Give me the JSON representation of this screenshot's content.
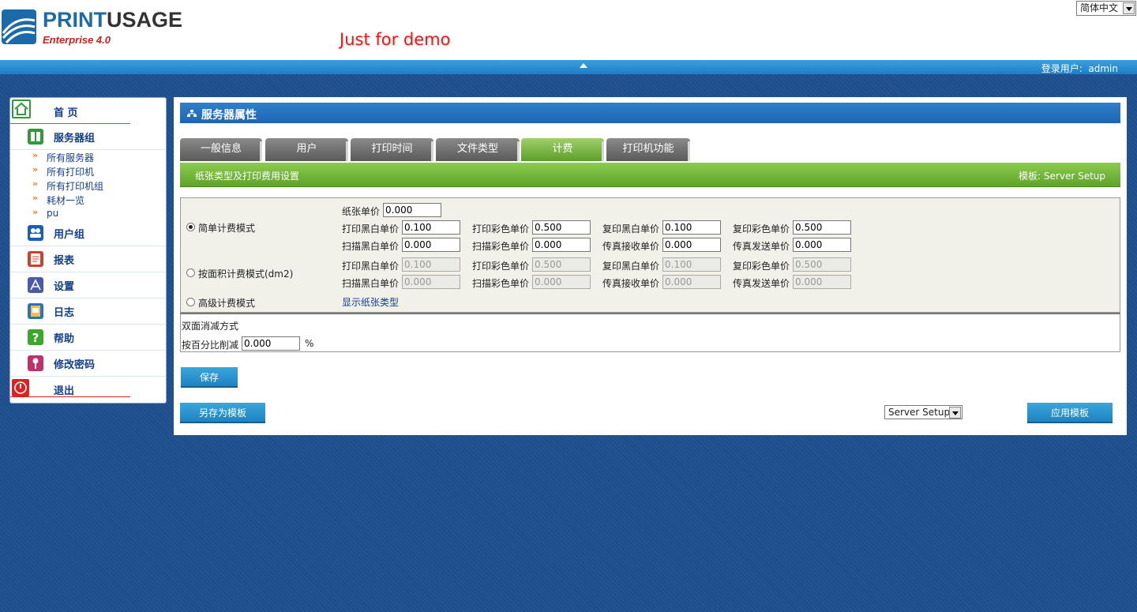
{
  "header": {
    "brand_part1": "PRINT",
    "brand_part2": "USAGE",
    "edition": "Enterprise 4.0",
    "demo_notice": "Just for demo",
    "language_select": "简体中文"
  },
  "top_bar": {
    "login_label": "登录用户:",
    "username": "admin"
  },
  "sidebar": {
    "items": [
      {
        "label": "首 页",
        "icon": "home-icon",
        "color": "#2e9a3a"
      },
      {
        "label": "服务器组",
        "icon": "server-group-icon",
        "color": "#2e9a3a"
      },
      {
        "label": "用户组",
        "icon": "user-group-icon",
        "color": "#1a5fb4"
      },
      {
        "label": "报表",
        "icon": "report-icon",
        "color": "#d0402a"
      },
      {
        "label": "设置",
        "icon": "settings-icon",
        "color": "#4a5aa8"
      },
      {
        "label": "日志",
        "icon": "log-icon",
        "color": "#2a72c0"
      },
      {
        "label": "帮助",
        "icon": "help-icon",
        "color": "#3aa82a"
      },
      {
        "label": "修改密码",
        "icon": "key-icon",
        "color": "#c0306a"
      },
      {
        "label": "退出",
        "icon": "power-icon",
        "color": "#e02020"
      }
    ],
    "sub_items": [
      "所有服务器",
      "所有打印机",
      "所有打印机组",
      "耗材一览",
      "pu"
    ]
  },
  "main": {
    "title": "服务器属性",
    "tabs": [
      "一般信息",
      "用户",
      "打印时间",
      "文件类型",
      "计费",
      "打印机功能"
    ],
    "active_tab": "计费",
    "section_title": "纸张类型及打印费用设置",
    "template_info": "模板: Server Setup",
    "billing": {
      "simple_mode": {
        "label": "简单计费模式",
        "selected": true,
        "paper_price_label": "纸张单价",
        "paper_price": "0.000",
        "row1": [
          {
            "label": "打印黑白单价",
            "value": "0.100"
          },
          {
            "label": "打印彩色单价",
            "value": "0.500"
          },
          {
            "label": "复印黑白单价",
            "value": "0.100"
          },
          {
            "label": "复印彩色单价",
            "value": "0.500"
          }
        ],
        "row2": [
          {
            "label": "扫描黑白单价",
            "value": "0.000"
          },
          {
            "label": "扫描彩色单价",
            "value": "0.000"
          },
          {
            "label": "传真接收单价",
            "value": "0.000"
          },
          {
            "label": "传真发送单价",
            "value": "0.000"
          }
        ]
      },
      "area_mode": {
        "label": "按面积计费模式(dm2)",
        "selected": false,
        "row1": [
          {
            "label": "打印黑白单价",
            "value": "0.100"
          },
          {
            "label": "打印彩色单价",
            "value": "0.500"
          },
          {
            "label": "复印黑白单价",
            "value": "0.100"
          },
          {
            "label": "复印彩色单价",
            "value": "0.500"
          }
        ],
        "row2": [
          {
            "label": "扫描黑白单价",
            "value": "0.000"
          },
          {
            "label": "扫描彩色单价",
            "value": "0.000"
          },
          {
            "label": "传真接收单价",
            "value": "0.000"
          },
          {
            "label": "传真发送单价",
            "value": "0.000"
          }
        ]
      },
      "advanced_mode": {
        "label": "高级计费模式",
        "selected": false,
        "link": "显示纸张类型"
      }
    },
    "duplex": {
      "title": "双面消减方式",
      "percent_label": "按百分比削减",
      "percent_value": "0.000",
      "unit": "%"
    },
    "buttons": {
      "save": "保存",
      "save_as_template": "另存为模板",
      "apply_template": "应用模板"
    },
    "template_select": "Server Setup"
  }
}
